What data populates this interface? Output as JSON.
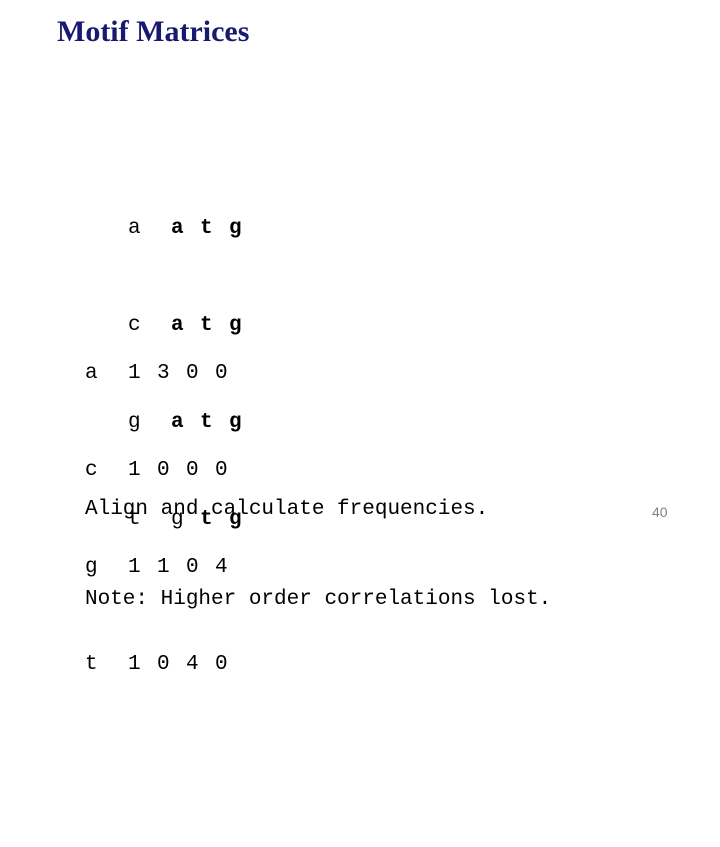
{
  "slide": {
    "title": "Motif Matrices",
    "title_color": "#191970",
    "background_color": "#ffffff",
    "page_number": "40",
    "page_number_color": "#808080"
  },
  "alignment_matrix": {
    "rows": [
      {
        "label": "a",
        "cells": [
          "a",
          "t",
          "g"
        ],
        "label_bold": false,
        "cell_bold": [
          true,
          true,
          true
        ]
      },
      {
        "label": "c",
        "cells": [
          "a",
          "t",
          "g"
        ],
        "label_bold": false,
        "cell_bold": [
          true,
          true,
          true
        ]
      },
      {
        "label": "g",
        "cells": [
          "a",
          "t",
          "g"
        ],
        "label_bold": false,
        "cell_bold": [
          true,
          true,
          true
        ]
      },
      {
        "label": "t",
        "cells": [
          "g",
          "t",
          "g"
        ],
        "label_bold": false,
        "cell_bold": [
          false,
          true,
          true
        ]
      }
    ]
  },
  "count_matrix": {
    "rows": [
      {
        "label": "a",
        "cells": [
          "1",
          "3",
          "0",
          "0"
        ]
      },
      {
        "label": "c",
        "cells": [
          "1",
          "0",
          "0",
          "0"
        ]
      },
      {
        "label": "g",
        "cells": [
          "1",
          "1",
          "0",
          "4"
        ]
      },
      {
        "label": "t",
        "cells": [
          "1",
          "0",
          "4",
          "0"
        ]
      }
    ]
  },
  "caption": {
    "lines": [
      "Align and calculate frequencies.",
      "Note: Higher order correlations lost."
    ]
  }
}
